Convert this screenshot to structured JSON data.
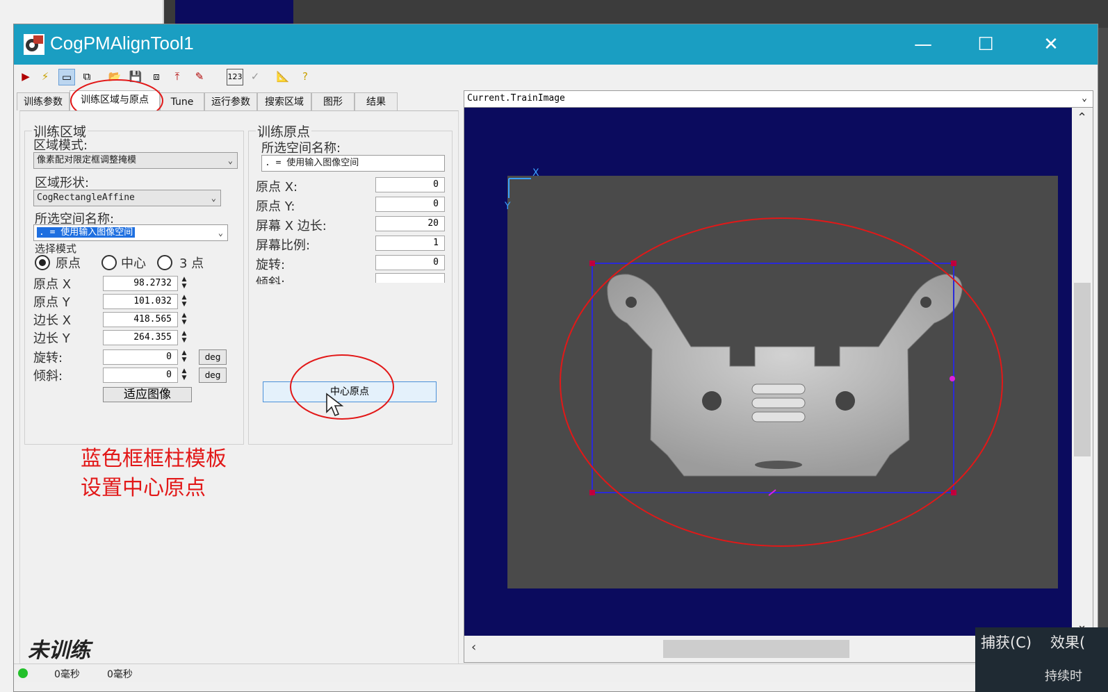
{
  "window": {
    "title": "CogPMAlignTool1",
    "minimize_glyph": "—",
    "maximize_glyph": "☐",
    "close_glyph": "✕"
  },
  "toolbar": {
    "icons": [
      "run-icon",
      "electric-icon",
      "grab-icon",
      "image-icon",
      "open-icon",
      "save-icon",
      "save-as-icon",
      "load-icon",
      "brush-icon",
      "numeric-icon",
      "check-icon",
      "ruler-icon",
      "help-icon"
    ]
  },
  "tabs": [
    {
      "label": "训练参数"
    },
    {
      "label": "训练区域与原点"
    },
    {
      "label": "Tune"
    },
    {
      "label": "运行参数"
    },
    {
      "label": "搜索区域"
    },
    {
      "label": "图形"
    },
    {
      "label": "结果"
    }
  ],
  "train_region": {
    "group_title": "训练区域",
    "region_mode_label": "区域模式:",
    "region_mode_value": "像素配对限定框调整掩模",
    "shape_label": "区域形状:",
    "shape_value": "CogRectangleAffine",
    "space_label": "所选空间名称:",
    "space_value": ". = 使用输入图像空间",
    "select_mode_label": "选择模式",
    "radios": [
      "原点",
      "中心",
      "3 点"
    ],
    "fields": [
      {
        "label": "原点 X",
        "value": "98.2732"
      },
      {
        "label": "原点 Y",
        "value": "101.032"
      },
      {
        "label": "边长 X",
        "value": "418.565"
      },
      {
        "label": "边长 Y",
        "value": "264.355"
      },
      {
        "label": "旋转:",
        "value": "0",
        "unit": "deg"
      },
      {
        "label": "倾斜:",
        "value": "0",
        "unit": "deg"
      }
    ],
    "fit_button": "适应图像"
  },
  "train_origin": {
    "group_title": "训练原点",
    "space_label": "所选空间名称:",
    "space_value": ". = 使用输入图像空间",
    "fields": [
      {
        "label": "原点 X:",
        "value": "0"
      },
      {
        "label": "原点 Y:",
        "value": "0"
      },
      {
        "label": "屏幕 X 边长:",
        "value": "20"
      },
      {
        "label": "屏幕比例:",
        "value": "1"
      },
      {
        "label": "旋转:",
        "value": "0"
      },
      {
        "label": "倾斜:",
        "value": ""
      }
    ],
    "center_button": "中心原点"
  },
  "annotation": {
    "line1": "蓝色框框柱模板",
    "line2": "设置中心原点"
  },
  "train_status": "未训练",
  "statusbar": {
    "time1": "0毫秒",
    "time2": "0毫秒"
  },
  "display": {
    "image_selector": "Current.TrainImage",
    "axis_x": "X",
    "axis_y": "Y"
  },
  "overlay_menu": {
    "capture": "捕获(C)",
    "effects": "效果(",
    "continuous": "持续时"
  }
}
